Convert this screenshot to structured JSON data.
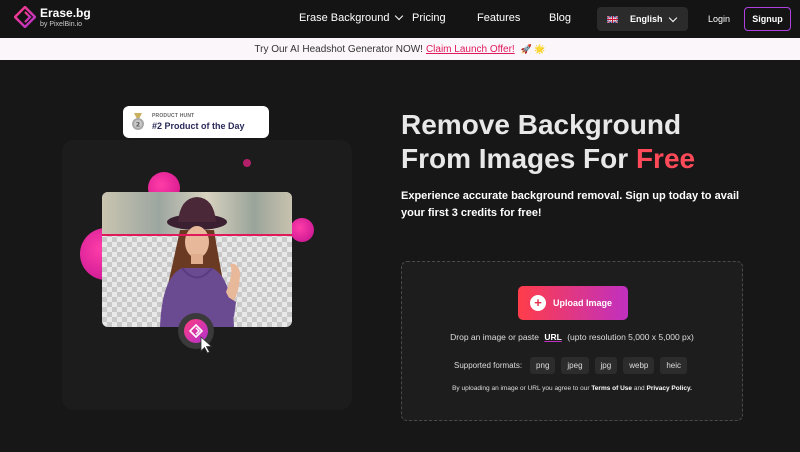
{
  "nav": {
    "logo_title": "Erase.bg",
    "logo_sub": "by PixelBin.io",
    "links": [
      "Erase Background",
      "Pricing",
      "Features",
      "Blog"
    ],
    "language": "English",
    "login": "Login",
    "signup": "Signup"
  },
  "banner": {
    "text": "Try Our AI Headshot Generator NOW!",
    "link": "Claim Launch Offer!",
    "emoji": "🚀 🌟"
  },
  "badge": {
    "small": "PRODUCT HUNT",
    "big": "#2 Product of the Day"
  },
  "hero": {
    "title_line1": "Remove Background",
    "title_line2_prefix": "From Images For",
    "title_highlight": "Free",
    "subtitle": "Experience accurate background removal. Sign up today to avail your first 3 credits for free!"
  },
  "upload": {
    "button": "Upload Image",
    "drop_prefix": "Drop an image or paste",
    "url_link": "URL",
    "drop_suffix": "(upto resolution 5,000 x 5,000 px)",
    "formats_label": "Supported formats:",
    "formats": [
      "png",
      "jpeg",
      "jpg",
      "webp",
      "heic"
    ],
    "terms_prefix": "By uploading an image or URL you agree to our",
    "terms_link": "Terms of Use",
    "terms_and": "and",
    "privacy_link": "Privacy Policy."
  },
  "colors": {
    "accent_pink": "#ff3da8",
    "accent_red": "#ff4a5a",
    "signup_border": "#b040e0"
  }
}
